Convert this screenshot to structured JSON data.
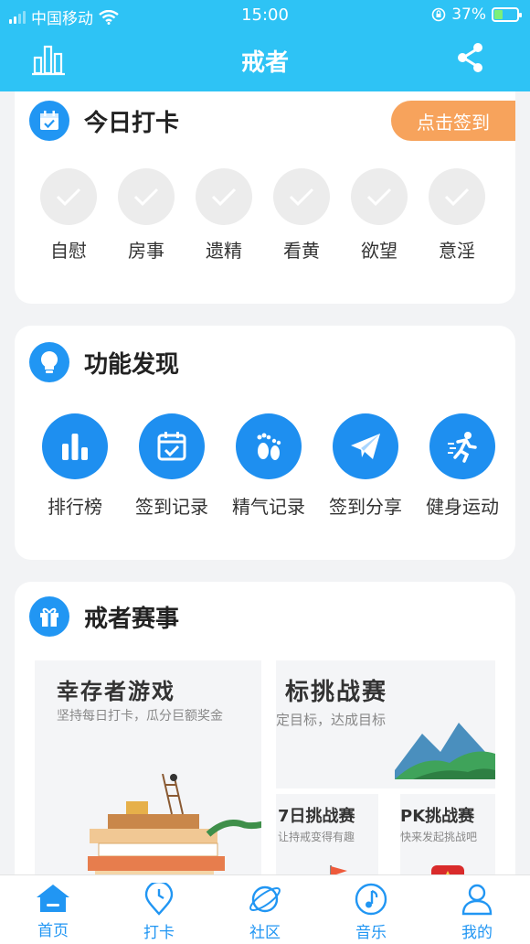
{
  "status_bar": {
    "carrier": "中国移动",
    "time": "15:00",
    "battery_percent": "37%",
    "battery_level": 0.37
  },
  "header": {
    "title": "戒者"
  },
  "checkin": {
    "title": "今日打卡",
    "button_label": "点击签到",
    "items": [
      {
        "label": "自慰"
      },
      {
        "label": "房事"
      },
      {
        "label": "遗精"
      },
      {
        "label": "看黄"
      },
      {
        "label": "欲望"
      },
      {
        "label": "意淫"
      }
    ]
  },
  "discover": {
    "title": "功能发现",
    "items": [
      {
        "label": "排行榜",
        "icon": "bar-chart-icon"
      },
      {
        "label": "签到记录",
        "icon": "calendar-check-icon"
      },
      {
        "label": "精气记录",
        "icon": "footprint-icon"
      },
      {
        "label": "签到分享",
        "icon": "paper-plane-icon"
      },
      {
        "label": "健身运动",
        "icon": "running-icon"
      }
    ]
  },
  "events": {
    "title": "戒者赛事",
    "survivor": {
      "title": "幸存者游戏",
      "subtitle": "坚持每日打卡，瓜分巨额奖金"
    },
    "target": {
      "title": "标挑战赛",
      "subtitle": "定目标，达成目标"
    },
    "seven_day": {
      "title": "7日挑战赛",
      "subtitle": "让持戒变得有趣"
    },
    "pk": {
      "title": "PK挑战赛",
      "subtitle": "快来发起挑战吧"
    }
  },
  "tabbar": {
    "active": "首页",
    "items": [
      {
        "label": "首页",
        "icon": "home-icon"
      },
      {
        "label": "打卡",
        "icon": "clock-pin-icon"
      },
      {
        "label": "社区",
        "icon": "planet-icon"
      },
      {
        "label": "音乐",
        "icon": "music-note-icon"
      },
      {
        "label": "我的",
        "icon": "user-icon"
      }
    ]
  },
  "colors": {
    "primary": "#2ec3f5",
    "accent_blue": "#1e8ff0",
    "orange": "#f7a35c"
  }
}
